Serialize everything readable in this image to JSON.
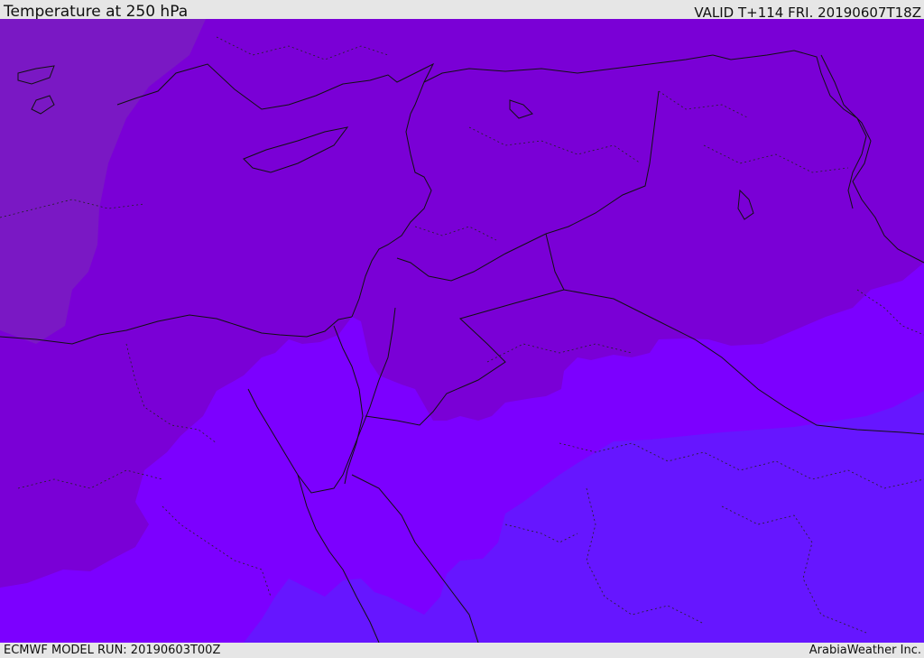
{
  "header": {
    "title": "Temperature at 250 hPa",
    "valid_time": "VALID T+114 FRI. 20190607T18Z"
  },
  "footer": {
    "model_run": "ECMWF MODEL RUN: 20190603T00Z",
    "credit": "ArabiaWeather Inc."
  },
  "colors": {
    "band_warmest": "#7a18c4",
    "band_warm": "#7a00d6",
    "band_mid": "#7c00ff",
    "band_cool": "#6616ff",
    "coast_line": "#111111"
  }
}
